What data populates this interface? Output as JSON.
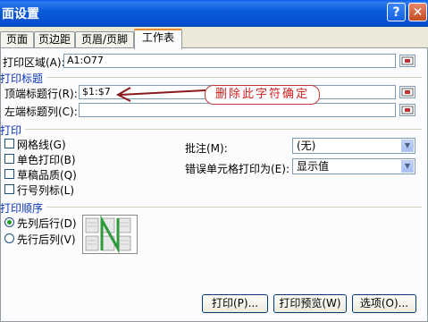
{
  "window": {
    "title": "面设置"
  },
  "tabs": [
    {
      "label": "页面"
    },
    {
      "label": "页边距"
    },
    {
      "label": "页眉/页脚"
    },
    {
      "label": "工作表"
    }
  ],
  "print_area": {
    "label": "打印区域(A):",
    "value": "A1:O77"
  },
  "print_titles": {
    "section": "打印标题",
    "rows_label": "顶端标题行(R):",
    "rows_value": "$1:$7",
    "cols_label": "左端标题列(C):",
    "cols_value": ""
  },
  "annotation": {
    "text": "删除此字符确定",
    "color": "#d21e1e"
  },
  "print": {
    "section": "打印",
    "options": [
      {
        "label": "网格线(G)",
        "checked": false
      },
      {
        "label": "单色打印(B)",
        "checked": false
      },
      {
        "label": "草稿品质(Q)",
        "checked": false
      },
      {
        "label": "行号列标(L)",
        "checked": false
      }
    ],
    "comments_label": "批注(M):",
    "comments_value": "(无)",
    "errors_label": "错误单元格打印为(E):",
    "errors_value": "显示值"
  },
  "order": {
    "section": "打印顺序",
    "options": [
      {
        "label": "先列后行(D)",
        "selected": true
      },
      {
        "label": "先行后列(V)",
        "selected": false
      }
    ]
  },
  "buttons": {
    "print": "打印(P)...",
    "preview": "打印预览(W)",
    "options": "选项(O)..."
  },
  "colors": {
    "title_bar": "#0a5ad8",
    "section_text": "#0b34b7",
    "tab_highlight": "#e68b2c"
  }
}
